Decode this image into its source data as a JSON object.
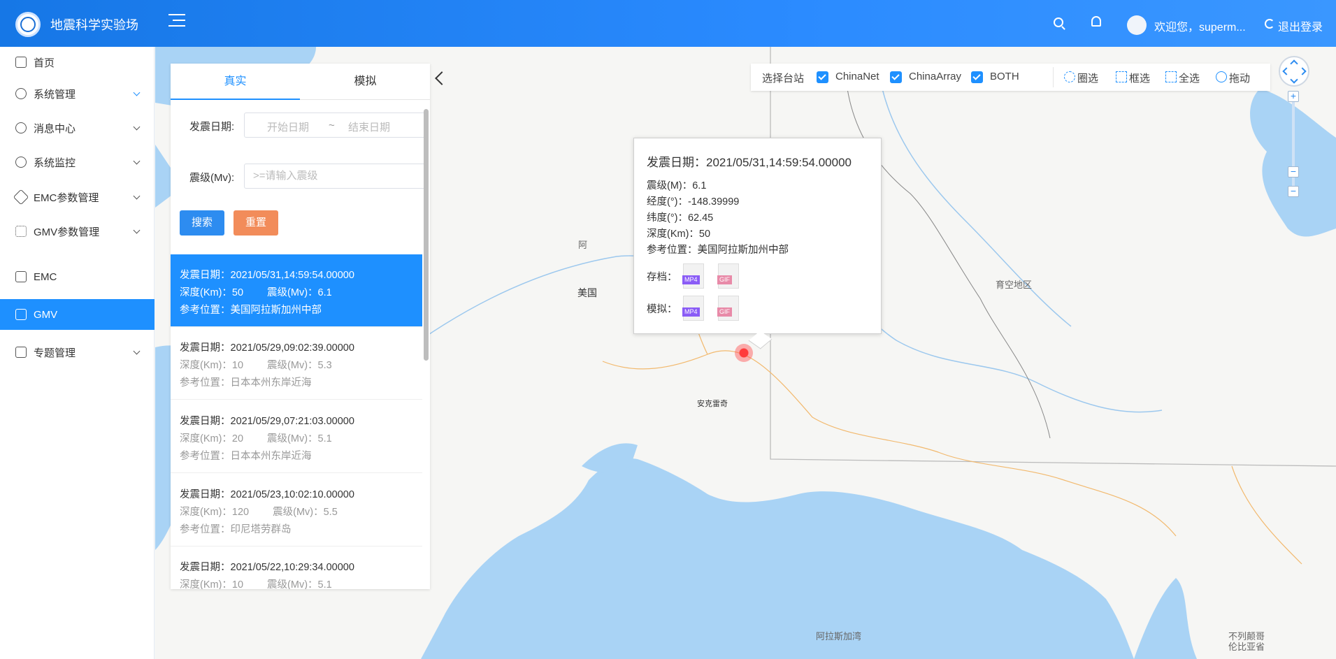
{
  "header": {
    "app_title": "地震科学实验场",
    "welcome": "欢迎您，superm...",
    "logout": "退出登录"
  },
  "sidebar": {
    "items": [
      {
        "label": "首页"
      },
      {
        "label": "系统管理"
      },
      {
        "label": "消息中心"
      },
      {
        "label": "系统监控"
      },
      {
        "label": "EMC参数管理"
      },
      {
        "label": "GMV参数管理"
      },
      {
        "label": "EMC"
      },
      {
        "label": "GMV"
      },
      {
        "label": "专题管理"
      }
    ]
  },
  "panel": {
    "tabs": [
      "真实",
      "模拟"
    ],
    "date_label": "发震日期:",
    "date_start_placeholder": "开始日期",
    "date_sep": "~",
    "date_end_placeholder": "结束日期",
    "mag_label": "震级(Mv):",
    "mag_placeholder": ">=请输入震级",
    "search_btn": "搜索",
    "reset_btn": "重置"
  },
  "events": [
    {
      "date": "发震日期：2021/05/31,14:59:54.00000",
      "depth": "深度(Km)：50",
      "mag": "震级(Mv)：6.1",
      "loc": "参考位置：美国阿拉斯加州中部"
    },
    {
      "date": "发震日期：2021/05/29,09:02:39.00000",
      "depth": "深度(Km)：10",
      "mag": "震级(Mv)：5.3",
      "loc": "参考位置：日本本州东岸近海"
    },
    {
      "date": "发震日期：2021/05/29,07:21:03.00000",
      "depth": "深度(Km)：20",
      "mag": "震级(Mv)：5.1",
      "loc": "参考位置：日本本州东岸近海"
    },
    {
      "date": "发震日期：2021/05/23,10:02:10.00000",
      "depth": "深度(Km)：120",
      "mag": "震级(Mv)：5.5",
      "loc": "参考位置：印尼塔劳群岛"
    },
    {
      "date": "发震日期：2021/05/22,10:29:34.00000",
      "depth": "深度(Km)：10",
      "mag": "震级(Mv)：5.1",
      "loc": ""
    }
  ],
  "toolbar": {
    "label": "选择台站",
    "stations": [
      "ChinaNet",
      "ChinaArray",
      "BOTH"
    ],
    "tools": [
      "圈选",
      "框选",
      "全选",
      "拖动"
    ]
  },
  "popup": {
    "title": "发震日期：2021/05/31,14:59:54.00000",
    "lines": [
      "震级(M)：6.1",
      "经度(°)：-148.39999",
      "纬度(°)：62.45",
      "深度(Km)：50",
      "参考位置：美国阿拉斯加州中部"
    ],
    "archive_label": "存档：",
    "sim_label": "模拟：",
    "mp4": "MP4",
    "gif": "GIF"
  },
  "map_labels": {
    "usa": "美国",
    "yukon": "育空地区",
    "anchorage": "安克雷奇",
    "gulf": "阿拉斯加湾",
    "bc": "不列颠哥\n伦比亚省",
    "partial": "阿"
  },
  "colors": {
    "header_start": "#1677e6",
    "accent": "#1e90ff",
    "reset": "#f28c5a",
    "water": "#a9d3f5"
  }
}
